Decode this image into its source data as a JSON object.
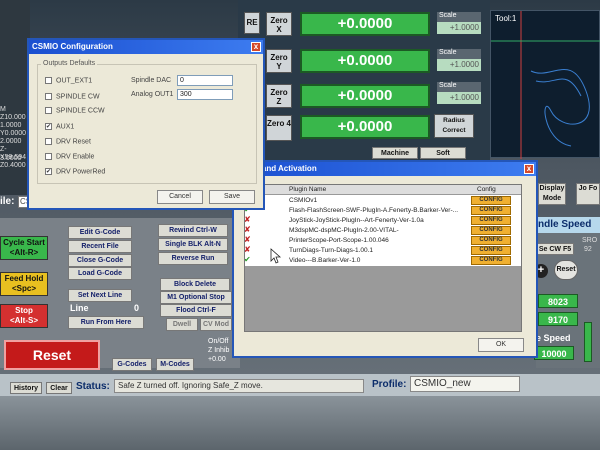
{
  "mach3": {
    "axes": [
      {
        "zero_label": "Zero X",
        "dro": "+0.0000",
        "scale_label": "Scale",
        "scale_value": "+1.0000"
      },
      {
        "zero_label": "Zero Y",
        "dro": "+0.0000",
        "scale_label": "Scale",
        "scale_value": "+1.0000"
      },
      {
        "zero_label": "Zero Z",
        "dro": "+0.0000",
        "scale_label": "Scale",
        "scale_value": "+1.0000"
      },
      {
        "zero_label": "Zero 4",
        "dro": "+0.0000",
        "radius_label": "Radius Correct"
      }
    ],
    "ref_label": "RE",
    "tool_label": "Tool:1",
    "left_numbers": [
      "M",
      "Z10.000",
      "1.0000",
      "Y0.0000",
      "2.0000",
      "Z-3.0000",
      "X59.594",
      "Z0.4000"
    ],
    "machine_tab": "Machine",
    "soft_tab": "Soft",
    "left_label": "ile:",
    "left_field": "CSMI",
    "buttons": {
      "cycle_start": "Cycle Start",
      "cycle_start_key": "<Alt-R>",
      "feed_hold": "Feed Hold",
      "feed_hold_key": "<Spc>",
      "stop": "Stop",
      "stop_key": "<Alt-S>",
      "edit_gcode": "Edit G-Code",
      "recent_file": "Recent File",
      "close_gcode": "Close G-Code",
      "load_gcode": "Load G-Code",
      "set_next_line": "Set Next Line",
      "line_label": "Line",
      "line_value": "0",
      "run_from_here": "Run From Here",
      "rewind": "Rewind Ctrl-W",
      "single_blk": "Single BLK Alt-N",
      "reverse_run": "Reverse Run",
      "block_delete": "Block Delete",
      "m1_optional_stop": "M1 Optional Stop",
      "flood": "Flood Ctrl-F",
      "dwell": "Dwell",
      "cv_mode": "CV Mod",
      "reset": "Reset",
      "gcodes": "G-Codes",
      "mcodes": "M-Codes",
      "history": "History",
      "clear": "Clear",
      "on_off": "On/Off",
      "z_inhibit": "Z Inhib",
      "z_inhibit_value": "+0.00",
      "display_mode": "Display Mode",
      "spindle_cw": "Se CW F5",
      "reset_small": "Reset"
    },
    "right_panel": {
      "spindle_speed_title": "ndle Speed",
      "sro_label": "SRO",
      "sro_value": "92",
      "rpm_1": "8023",
      "rpm_2": "9170",
      "speed_label": "e Speed",
      "speed_value": "10000",
      "jog_label": "Jo Fo"
    },
    "status_label": "Status:",
    "status_text": "Safe Z turned off. Ignoring Safe_Z move.",
    "profile_label": "Profile:",
    "profile_value": "CSMIO_new"
  },
  "csmio_dialog": {
    "title": "CSMIO Configuration",
    "close": "x",
    "group_label": "Outputs Defaults",
    "outputs": [
      {
        "label": "OUT_EXT1",
        "checked": false
      },
      {
        "label": "SPINDLE CW",
        "checked": false
      },
      {
        "label": "SPINDLE CCW",
        "checked": false
      },
      {
        "label": "AUX1",
        "checked": true
      },
      {
        "label": "DRV Reset",
        "checked": false
      },
      {
        "label": "DRV Enable",
        "checked": false
      },
      {
        "label": "DRV PowerRed",
        "checked": true
      }
    ],
    "spindle_dac_label": "Spindle DAC",
    "spindle_dac_value": "0",
    "analog_out_label": "Analog OUT1",
    "analog_out_value": "300",
    "cancel": "Cancel",
    "save": "Save"
  },
  "plugin_dialog": {
    "title": "ontrol and Activation",
    "close": "x",
    "col_name": "Plugin Name",
    "col_config": "Config",
    "rows": [
      {
        "name": "CSMIOv1",
        "enabled": true,
        "config": "CONFIG"
      },
      {
        "name": "Flash-FlashScreen-SWF-PlugIn-A.Fenerty-B.Barker-Ver-...",
        "enabled": true,
        "config": "CONFIG"
      },
      {
        "name": "JoyStick-JoyStick-PlugIn--Art-Fenerty-Ver-1.0a",
        "enabled": false,
        "config": "CONFIG"
      },
      {
        "name": "M3dspMC-dspMC-PlugIn-2.00-VITAL-",
        "enabled": false,
        "config": "CONFIG"
      },
      {
        "name": "PrinterScope-Port-Scope-1.00.046",
        "enabled": false,
        "config": "CONFIG"
      },
      {
        "name": "TurnDiags-Turn-Diags-1.00.1",
        "enabled": false,
        "config": "CONFIG"
      },
      {
        "name": "Video---B.Barker-Ver-1.0",
        "enabled": true,
        "config": "CONFIG"
      }
    ],
    "ok": "OK"
  }
}
